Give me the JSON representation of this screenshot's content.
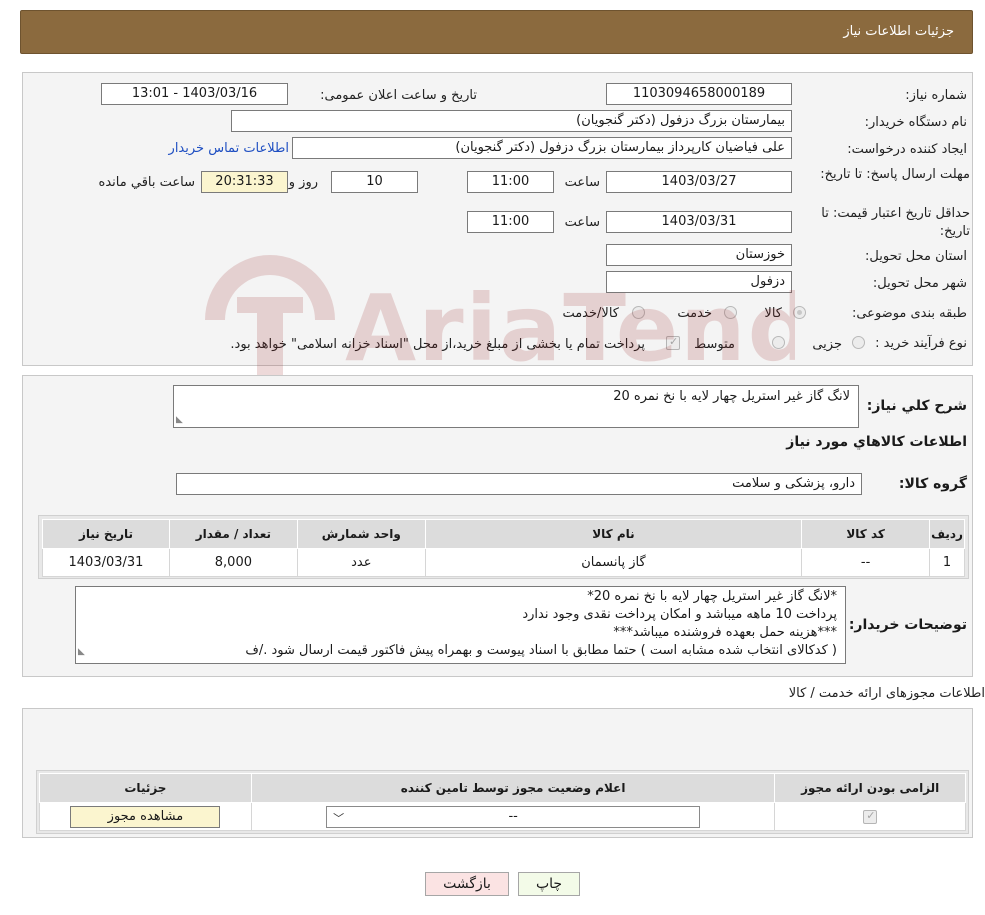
{
  "header": {
    "title": "جزئیات اطلاعات نیاز"
  },
  "need": {
    "number_label": "شماره نیاز:",
    "number": "1103094658000189",
    "announce_label": "تاریخ و ساعت اعلان عمومی:",
    "announce": "1403/03/16 - 13:01",
    "buyer_label": "نام دستگاه خریدار:",
    "buyer": "بیمارستان بزرگ دزفول (دکتر گنجویان)",
    "creator_label": "ایجاد کننده درخواست:",
    "creator": "علی فیاضیان کارپرداز بیمارستان بزرگ دزفول (دکتر گنجویان)",
    "contact_link": "اطلاعات تماس خریدار",
    "deadline_label": "مهلت ارسال پاسخ: تا تاریخ:",
    "deadline_date": "1403/03/27",
    "time_label": "ساعت",
    "deadline_time": "11:00",
    "days": "10",
    "days_label": "روز و",
    "remaining": "20:31:33",
    "remaining_label": "ساعت باقي مانده",
    "validity_label": "حداقل تاریخ اعتبار قیمت: تا تاریخ:",
    "validity_date": "1403/03/31",
    "validity_time": "11:00",
    "province_label": "استان محل تحویل:",
    "province": "خوزستان",
    "city_label": "شهر محل تحویل:",
    "city": "دزفول",
    "category_label": "طبقه بندی موضوعی:",
    "category_options": [
      "کالا",
      "خدمت",
      "کالا/خدمت"
    ],
    "process_label": "نوع فرآیند خرید :",
    "process_options": [
      "جزیی",
      "متوسط"
    ],
    "process_note": "پرداخت تمام یا بخشی از مبلغ خرید،از محل \"اسناد خزانه اسلامی\" خواهد بود."
  },
  "description": {
    "label": "شرح کلي نياز:",
    "text": "لانگ گاز غیر استریل چهار لایه با نخ نمره 20",
    "goods_title": "اطلاعات کالاهاي مورد نياز",
    "group_label": "گروه کالا:",
    "group": "دارو، پزشکی و سلامت"
  },
  "goods_table": {
    "headers": [
      "ردیف",
      "کد کالا",
      "نام کالا",
      "واحد شمارش",
      "تعداد / مقدار",
      "تاریخ نیاز"
    ],
    "rows": [
      [
        "1",
        "--",
        "گاز پانسمان",
        "عدد",
        "8,000",
        "1403/03/31"
      ]
    ]
  },
  "buyer_notes": {
    "label": "توضیحات خریدار:",
    "lines": [
      "*لانگ گاز غیر استریل چهار لایه با نخ نمره 20*",
      "پرداخت 10 ماهه میباشد و امکان پرداخت نقدی وجود ندارد",
      "***هزینه حمل بعهده فروشنده میباشد***",
      "( کدکالای انتخاب شده مشابه است ) حتما مطابق با اسناد پیوست و بهمراه پیش فاکتور قیمت ارسال شود ./ف"
    ]
  },
  "permits": {
    "title": "اطلاعات مجوزهای ارائه خدمت / کالا",
    "headers": [
      "الزامی بودن ارائه مجوز",
      "اعلام وضعیت مجوز توسط تامین کننده",
      "جزئیات"
    ],
    "select_value": "--",
    "view_button": "مشاهده مجوز"
  },
  "buttons": {
    "print": "چاپ",
    "back": "بازگشت"
  },
  "watermark": {
    "text": "AriaTender.neT"
  }
}
